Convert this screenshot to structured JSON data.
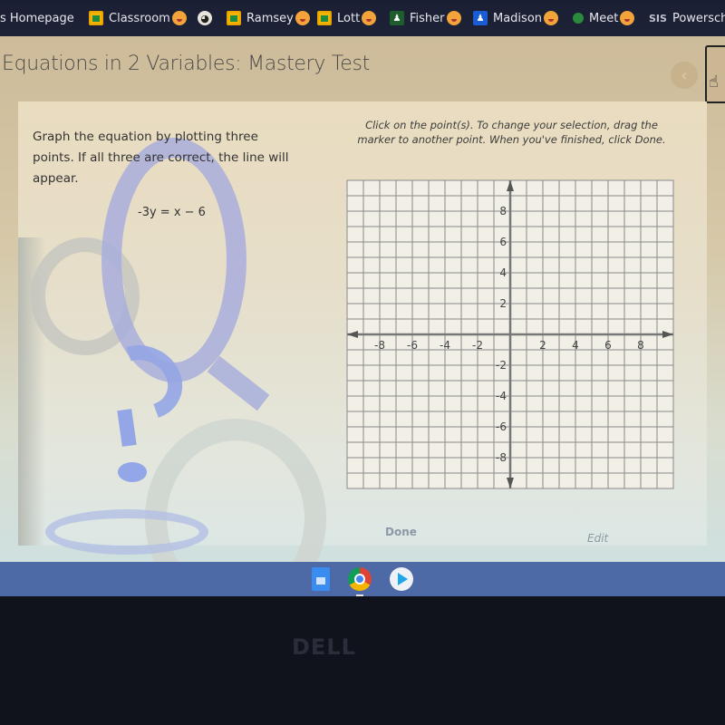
{
  "bookmarks": [
    {
      "label": "s Homepage",
      "icon": "none"
    },
    {
      "label": "Classroom",
      "icon": "classroom-icon",
      "emoji": "weary-face"
    },
    {
      "label": "",
      "icon": "globe-icon"
    },
    {
      "label": "Ramsey",
      "icon": "classroom-icon",
      "emoji": "smiling-face"
    },
    {
      "label": "Lott",
      "icon": "classroom-icon",
      "emoji": "smiling-face"
    },
    {
      "label": "Fisher",
      "icon": "person-icon",
      "emoji": "smiling-hearts-face"
    },
    {
      "label": "Madison",
      "icon": "person-icon",
      "emoji": "zany-face"
    },
    {
      "label": "Meet",
      "icon": "meet-icon",
      "emoji": "grinning-face"
    },
    {
      "label": "Powersch",
      "icon": "sis-icon",
      "icon_text": "SIS"
    }
  ],
  "page": {
    "title": "Equations in 2 Variables: Mastery Test",
    "back_glyph": "‹"
  },
  "question": {
    "instructions": "Graph the equation by plotting three points. If all three are correct, the line will appear.",
    "equation": "-3y = x − 6"
  },
  "directions": "Click on the point(s). To change your selection, drag the marker to another point. When you've finished, click Done.",
  "graph": {
    "x_range": [
      -10,
      10
    ],
    "y_range": [
      -10,
      10
    ],
    "grid_step": 1,
    "x_tick_labels": [
      "-8",
      "-6",
      "-4",
      "-2",
      "2",
      "4",
      "6",
      "8"
    ],
    "x_tick_values": [
      -8,
      -6,
      -4,
      -2,
      2,
      4,
      6,
      8
    ],
    "y_tick_labels": [
      "8",
      "6",
      "4",
      "2",
      "-2",
      "-4",
      "-6",
      "-8"
    ],
    "y_tick_values": [
      8,
      6,
      4,
      2,
      -2,
      -4,
      -6,
      -8
    ],
    "plotted_points": []
  },
  "buttons": {
    "done": "Done",
    "edit": "Edit"
  },
  "shelf": {
    "apps": [
      "Docs",
      "Chrome",
      "Play Store"
    ]
  },
  "hardware": {
    "brand": "DELL"
  }
}
